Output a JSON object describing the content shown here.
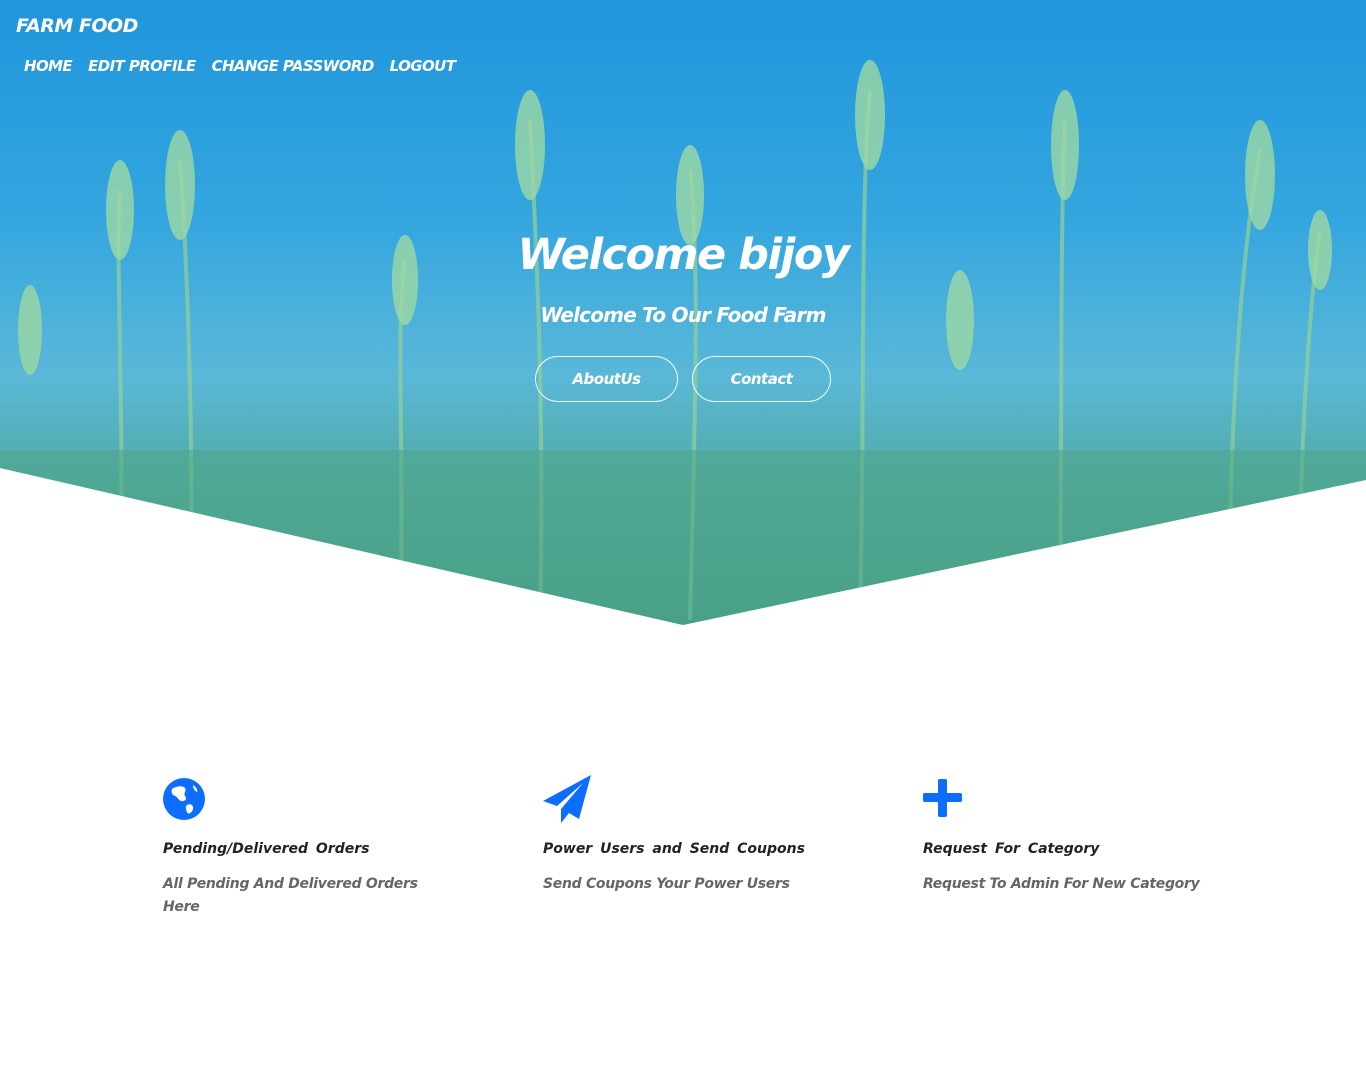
{
  "brand": "FARM FOOD",
  "nav": {
    "home": "HOME",
    "edit_profile": "EDIT PROFILE",
    "change_password": "CHANGE PASSWORD",
    "logout": "LOGOUT"
  },
  "hero": {
    "title": "Welcome bijoy",
    "subtitle": "Welcome To Our Food Farm",
    "about_label": "AboutUs",
    "contact_label": "Contact"
  },
  "features": [
    {
      "icon": "globe-icon",
      "title": "Pending/Delivered Orders",
      "text": "All Pending And Delivered Orders Here"
    },
    {
      "icon": "paper-plane-icon",
      "title": "Power Users and Send Coupons",
      "text": "Send Coupons Your Power Users"
    },
    {
      "icon": "plus-icon",
      "title": "Request For Category",
      "text": "Request To Admin For New Category"
    }
  ],
  "colors": {
    "accent": "#0d6efd",
    "hero_sky": "#1f95dc",
    "hero_field": "#3f9a7f"
  }
}
